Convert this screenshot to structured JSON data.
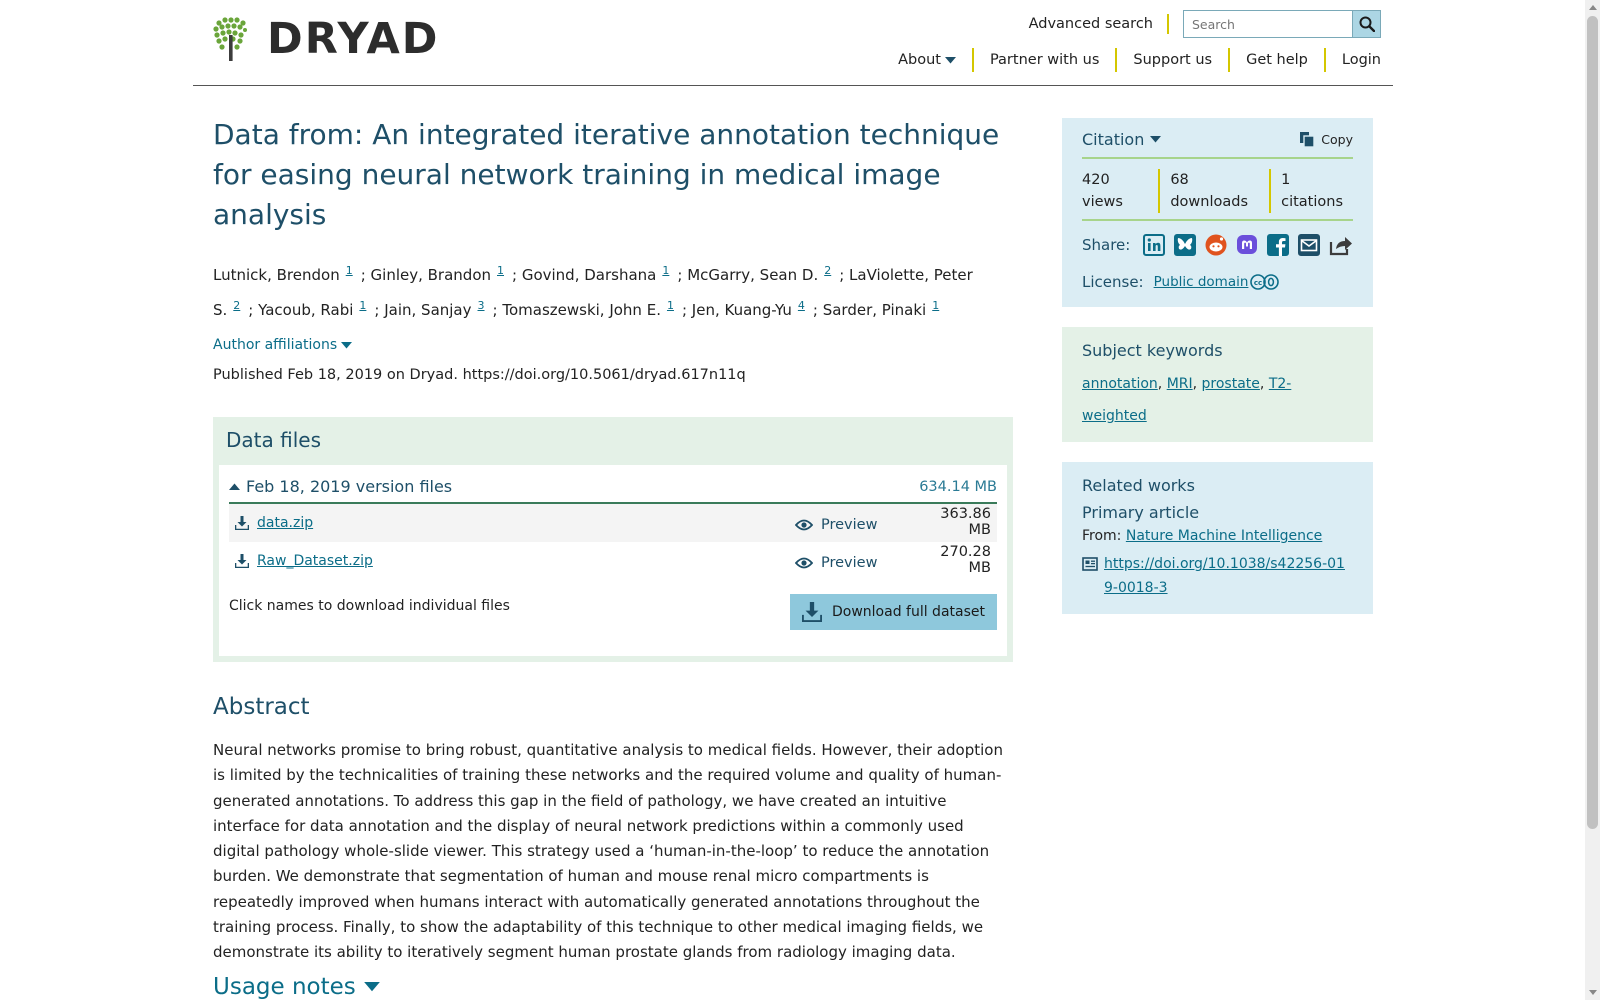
{
  "header": {
    "logo_text": "DRYAD",
    "advanced_search": "Advanced search",
    "search_placeholder": "Search",
    "nav": [
      "About",
      "Partner with us",
      "Support us",
      "Get help",
      "Login"
    ]
  },
  "dataset": {
    "title": "Data from: An integrated iterative annotation technique for easing neural network training in medical image analysis",
    "authors": [
      {
        "name": "Lutnick, Brendon",
        "aff": "1"
      },
      {
        "name": "Ginley, Brandon",
        "aff": "1"
      },
      {
        "name": "Govind, Darshana",
        "aff": "1"
      },
      {
        "name": "McGarry, Sean D.",
        "aff": "2"
      },
      {
        "name": "LaViolette, Peter S.",
        "aff": "2"
      },
      {
        "name": "Yacoub, Rabi",
        "aff": "1"
      },
      {
        "name": "Jain, Sanjay",
        "aff": "3"
      },
      {
        "name": "Tomaszewski, John E.",
        "aff": "1"
      },
      {
        "name": "Jen, Kuang-Yu",
        "aff": "4"
      },
      {
        "name": "Sarder, Pinaki",
        "aff": "1"
      }
    ],
    "author_affiliations_label": "Author affiliations",
    "published_line": "Published Feb 18, 2019 on Dryad. https://doi.org/10.5061/dryad.617n11q"
  },
  "data_files": {
    "heading": "Data files",
    "version_label": "Feb 18, 2019 version files",
    "version_size": "634.14 MB",
    "preview_label": "Preview",
    "files": [
      {
        "name": "data.zip",
        "size": "363.86 MB"
      },
      {
        "name": "Raw_Dataset.zip",
        "size": "270.28 MB"
      }
    ],
    "hint": "Click names to download individual files",
    "download_button": "Download full dataset"
  },
  "abstract": {
    "heading": "Abstract",
    "text": "Neural networks promise to bring robust, quantitative analysis to medical fields. However, their adoption is limited by the technicalities of training these networks and the required volume and quality of human-generated annotations. To address this gap in the field of pathology, we have created an intuitive interface for data annotation and the display of neural network predictions within a commonly used digital pathology whole-slide viewer. This strategy used a ‘human-in-the-loop’ to reduce the annotation burden. We demonstrate that segmentation of human and mouse renal micro compartments is repeatedly improved when humans interact with automatically generated annotations throughout the training process. Finally, to show the adaptability of this technique to other medical imaging fields, we demonstrate its ability to iteratively segment human prostate glands from radiology imaging data."
  },
  "usage_notes": {
    "heading": "Usage notes"
  },
  "citation": {
    "label": "Citation",
    "copy_label": "Copy",
    "views_num": "420",
    "views_label": "views",
    "downloads_num": "68",
    "downloads_label": "downloads",
    "citations_num": "1",
    "citations_label": "citations",
    "share_label": "Share:",
    "share_icons": [
      "linkedin-icon",
      "bluesky-icon",
      "reddit-icon",
      "mastodon-icon",
      "facebook-icon",
      "email-icon",
      "share-icon"
    ],
    "license_label": "License:",
    "license_value": "Public domain"
  },
  "keywords": {
    "heading": "Subject keywords",
    "items": [
      "annotation",
      "MRI",
      "prostate",
      "T2-weighted"
    ]
  },
  "related": {
    "heading": "Related works",
    "primary_label": "Primary article",
    "from_label": "From:",
    "journal": "Nature Machine Intelligence",
    "doi": "https://doi.org/10.1038/s42256-019-0018-3"
  },
  "colors": {
    "title_blue": "#1e4f68",
    "link": "#0b6d88",
    "panel_blue": "#dbedf4",
    "panel_green": "#e4f1e7",
    "accent_yellow": "#d4c700",
    "button_blue": "#8ec8dc"
  }
}
